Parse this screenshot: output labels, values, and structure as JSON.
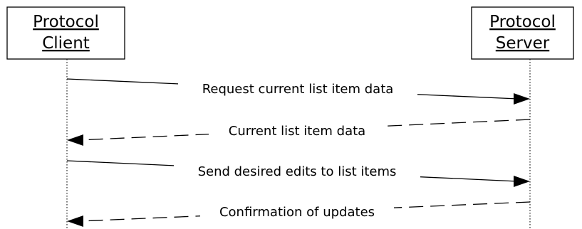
{
  "participants": {
    "client": {
      "line1": "Protocol",
      "line2": "Client"
    },
    "server": {
      "line1": "Protocol",
      "line2": "Server"
    }
  },
  "messages": [
    {
      "label": "Request current list item data",
      "direction": "client-to-server",
      "style": "solid"
    },
    {
      "label": "Current list item data",
      "direction": "server-to-client",
      "style": "dashed"
    },
    {
      "label": "Send desired edits to list items",
      "direction": "client-to-server",
      "style": "solid"
    },
    {
      "label": "Confirmation of updates",
      "direction": "server-to-client",
      "style": "dashed"
    }
  ]
}
